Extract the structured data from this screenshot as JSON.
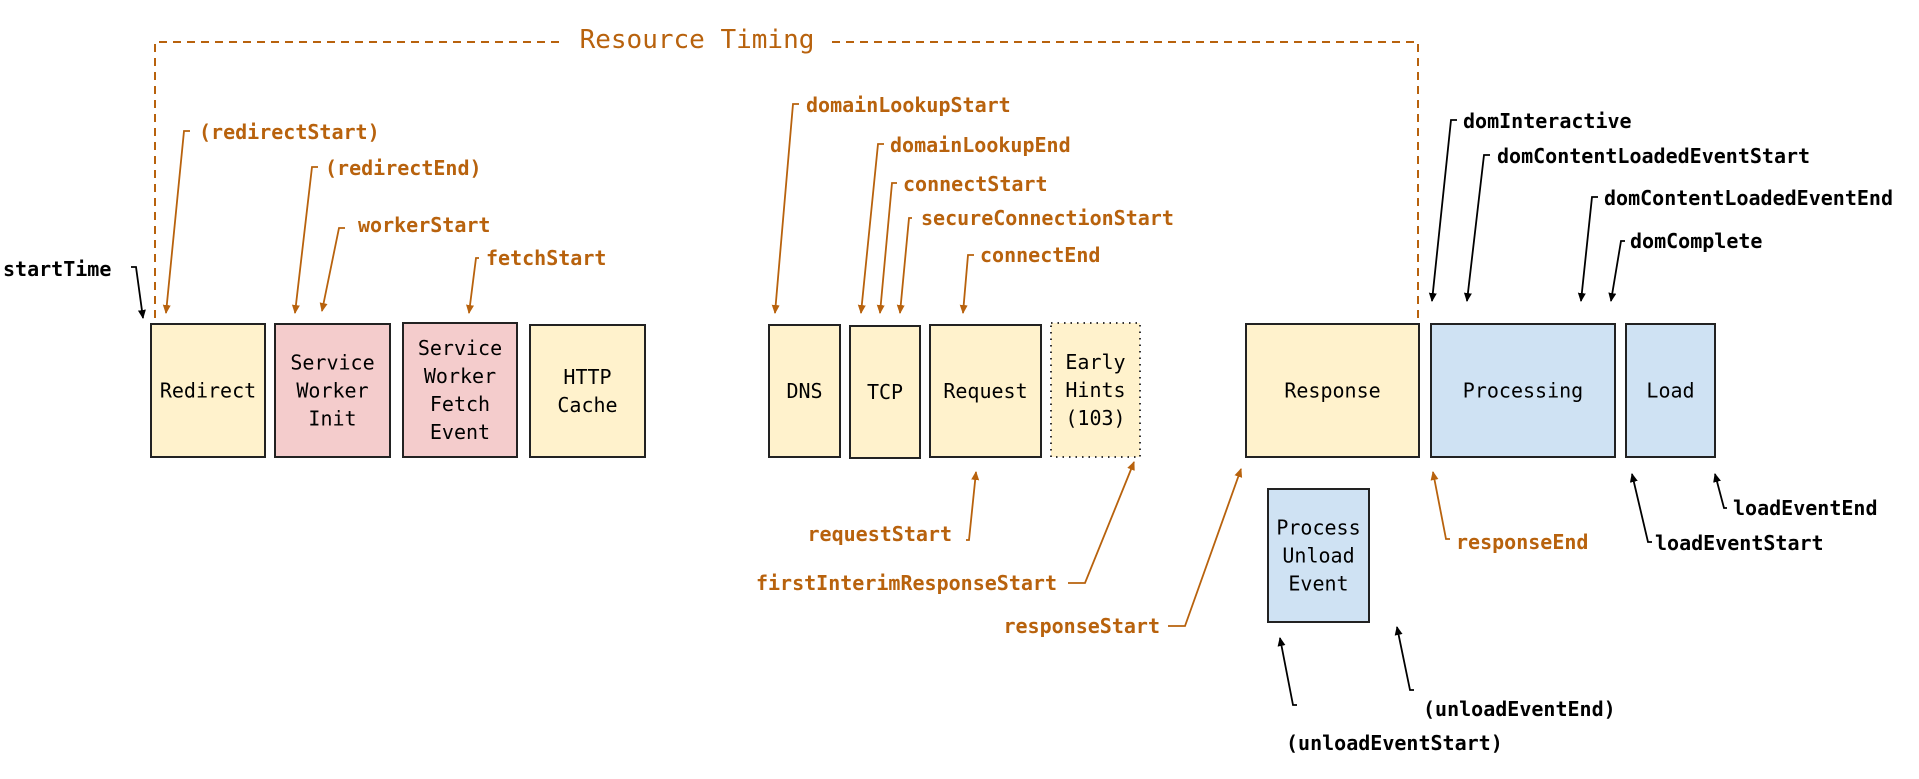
{
  "colors": {
    "resource_timing": "#B8620D",
    "navigation": "#000000",
    "network_phase_fill": "#FFF2CC",
    "service_worker_fill": "#F4CCCC",
    "document_phase_fill": "#CFE2F3",
    "box_border": "#222222"
  },
  "bracket": {
    "title": "Resource Timing"
  },
  "phases": [
    {
      "id": "redirect",
      "lines": [
        "Redirect"
      ],
      "kind": "network"
    },
    {
      "id": "service-worker-init",
      "lines": [
        "Service",
        "Worker",
        "Init"
      ],
      "kind": "service_worker"
    },
    {
      "id": "service-worker-fetch-event",
      "lines": [
        "Service",
        "Worker",
        "Fetch",
        "Event"
      ],
      "kind": "service_worker"
    },
    {
      "id": "http-cache",
      "lines": [
        "HTTP",
        "Cache"
      ],
      "kind": "network"
    },
    {
      "id": "dns",
      "lines": [
        "DNS"
      ],
      "kind": "network"
    },
    {
      "id": "tcp",
      "lines": [
        "TCP"
      ],
      "kind": "network"
    },
    {
      "id": "request",
      "lines": [
        "Request"
      ],
      "kind": "network"
    },
    {
      "id": "early-hints",
      "lines": [
        "Early",
        "Hints",
        "(103)"
      ],
      "kind": "network",
      "dotted": true
    },
    {
      "id": "response",
      "lines": [
        "Response"
      ],
      "kind": "network"
    },
    {
      "id": "processing",
      "lines": [
        "Processing"
      ],
      "kind": "document"
    },
    {
      "id": "load",
      "lines": [
        "Load"
      ],
      "kind": "document"
    },
    {
      "id": "process-unload-event",
      "lines": [
        "Process",
        "Unload",
        "Event"
      ],
      "kind": "document"
    }
  ],
  "markers": [
    {
      "id": "startTime",
      "text": "startTime",
      "group": "navigation"
    },
    {
      "id": "redirectStart",
      "text": "(redirectStart)",
      "group": "resource_timing"
    },
    {
      "id": "redirectEnd",
      "text": "(redirectEnd)",
      "group": "resource_timing"
    },
    {
      "id": "workerStart",
      "text": "workerStart",
      "group": "resource_timing"
    },
    {
      "id": "fetchStart",
      "text": "fetchStart",
      "group": "resource_timing"
    },
    {
      "id": "domainLookupStart",
      "text": "domainLookupStart",
      "group": "resource_timing"
    },
    {
      "id": "domainLookupEnd",
      "text": "domainLookupEnd",
      "group": "resource_timing"
    },
    {
      "id": "connectStart",
      "text": "connectStart",
      "group": "resource_timing"
    },
    {
      "id": "secureConnectionStart",
      "text": "secureConnectionStart",
      "group": "resource_timing"
    },
    {
      "id": "connectEnd",
      "text": "connectEnd",
      "group": "resource_timing"
    },
    {
      "id": "requestStart",
      "text": "requestStart",
      "group": "resource_timing"
    },
    {
      "id": "firstInterimResponseStart",
      "text": "firstInterimResponseStart",
      "group": "resource_timing"
    },
    {
      "id": "responseStart",
      "text": "responseStart",
      "group": "resource_timing"
    },
    {
      "id": "responseEnd",
      "text": "responseEnd",
      "group": "resource_timing"
    },
    {
      "id": "domInteractive",
      "text": "domInteractive",
      "group": "navigation"
    },
    {
      "id": "domContentLoadedEventStart",
      "text": "domContentLoadedEventStart",
      "group": "navigation"
    },
    {
      "id": "domContentLoadedEventEnd",
      "text": "domContentLoadedEventEnd",
      "group": "navigation"
    },
    {
      "id": "domComplete",
      "text": "domComplete",
      "group": "navigation"
    },
    {
      "id": "loadEventStart",
      "text": "loadEventStart",
      "group": "navigation"
    },
    {
      "id": "loadEventEnd",
      "text": "loadEventEnd",
      "group": "navigation"
    },
    {
      "id": "unloadEventStart",
      "text": "(unloadEventStart)",
      "group": "navigation"
    },
    {
      "id": "unloadEventEnd",
      "text": "(unloadEventEnd)",
      "group": "navigation"
    }
  ]
}
